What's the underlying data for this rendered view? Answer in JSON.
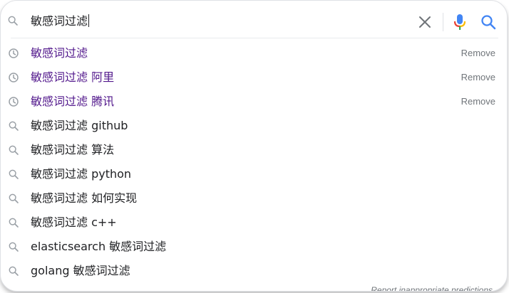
{
  "search": {
    "query": "敏感词过滤",
    "clear_label": "Clear",
    "voice_label": "Search by voice",
    "submit_label": "Search"
  },
  "suggestions": [
    {
      "text": "敏感词过滤",
      "type": "history",
      "icon": "clock-icon",
      "remove": "Remove"
    },
    {
      "text": "敏感词过滤 阿里",
      "type": "history",
      "icon": "clock-icon",
      "remove": "Remove"
    },
    {
      "text": "敏感词过滤 腾讯",
      "type": "history",
      "icon": "clock-icon",
      "remove": "Remove"
    },
    {
      "text": "敏感词过滤 github",
      "type": "search",
      "icon": "search-icon"
    },
    {
      "text": "敏感词过滤 算法",
      "type": "search",
      "icon": "search-icon"
    },
    {
      "text": "敏感词过滤 python",
      "type": "search",
      "icon": "search-icon"
    },
    {
      "text": "敏感词过滤 如何实现",
      "type": "search",
      "icon": "search-icon"
    },
    {
      "text": "敏感词过滤 c++",
      "type": "search",
      "icon": "search-icon"
    },
    {
      "text": "elasticsearch 敏感词过滤",
      "type": "search",
      "icon": "search-icon"
    },
    {
      "text": "golang 敏感词过滤",
      "type": "search",
      "icon": "search-icon"
    }
  ],
  "footer": {
    "report_link": "Report inappropriate predictions"
  },
  "colors": {
    "history_text": "#52188c",
    "icon_grey": "#9aa0a6",
    "search_blue": "#4285f4",
    "mic_red": "#ea4335",
    "mic_yellow": "#fbbc04",
    "mic_green": "#34a853"
  }
}
